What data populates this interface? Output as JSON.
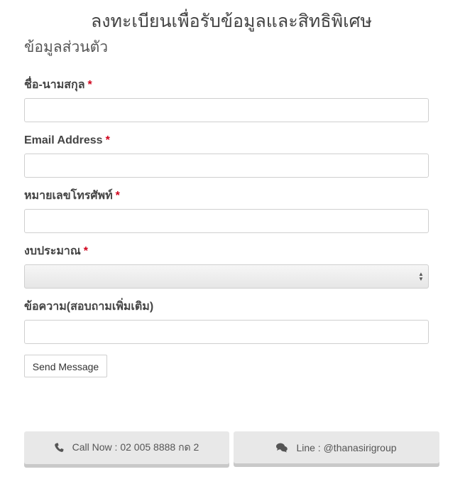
{
  "header": {
    "title": "ลงทะเบียนเพื่อรับข้อมูลและสิทธิพิเศษ",
    "section_title": "ข้อมูลส่วนตัว"
  },
  "form": {
    "required_marker": "*",
    "name": {
      "label": "ชื่อ-นามสกุล",
      "value": "",
      "placeholder": ""
    },
    "email": {
      "label": "Email Address",
      "value": "",
      "placeholder": ""
    },
    "phone": {
      "label": "หมายเลขโทรศัพท์",
      "value": "",
      "placeholder": ""
    },
    "budget": {
      "label": "งบประมาณ",
      "selected": ""
    },
    "message": {
      "label": "ข้อความ(สอบถามเพิ่มเติม)",
      "value": "",
      "placeholder": ""
    },
    "send_label": "Send Message"
  },
  "contact": {
    "call_label": "Call Now : 02 005 8888 กด 2",
    "call_icon": "phone-icon",
    "line_label": "Line : @thanasirigroup",
    "line_icon": "chat-bubbles-icon"
  },
  "colors": {
    "required": "#d0021b",
    "button_bg": "#e8e8e8",
    "button_shadow": "#c9c9c9"
  }
}
